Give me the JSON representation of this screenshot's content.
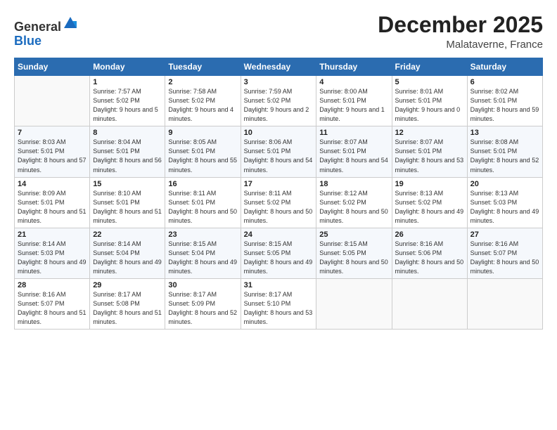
{
  "header": {
    "logo_line1": "General",
    "logo_line2": "Blue",
    "month": "December 2025",
    "location": "Malataverne, France"
  },
  "weekdays": [
    "Sunday",
    "Monday",
    "Tuesday",
    "Wednesday",
    "Thursday",
    "Friday",
    "Saturday"
  ],
  "weeks": [
    [
      {
        "day": "",
        "sunrise": "",
        "sunset": "",
        "daylight": ""
      },
      {
        "day": "1",
        "sunrise": "Sunrise: 7:57 AM",
        "sunset": "Sunset: 5:02 PM",
        "daylight": "Daylight: 9 hours and 5 minutes."
      },
      {
        "day": "2",
        "sunrise": "Sunrise: 7:58 AM",
        "sunset": "Sunset: 5:02 PM",
        "daylight": "Daylight: 9 hours and 4 minutes."
      },
      {
        "day": "3",
        "sunrise": "Sunrise: 7:59 AM",
        "sunset": "Sunset: 5:02 PM",
        "daylight": "Daylight: 9 hours and 2 minutes."
      },
      {
        "day": "4",
        "sunrise": "Sunrise: 8:00 AM",
        "sunset": "Sunset: 5:01 PM",
        "daylight": "Daylight: 9 hours and 1 minute."
      },
      {
        "day": "5",
        "sunrise": "Sunrise: 8:01 AM",
        "sunset": "Sunset: 5:01 PM",
        "daylight": "Daylight: 9 hours and 0 minutes."
      },
      {
        "day": "6",
        "sunrise": "Sunrise: 8:02 AM",
        "sunset": "Sunset: 5:01 PM",
        "daylight": "Daylight: 8 hours and 59 minutes."
      }
    ],
    [
      {
        "day": "7",
        "sunrise": "Sunrise: 8:03 AM",
        "sunset": "Sunset: 5:01 PM",
        "daylight": "Daylight: 8 hours and 57 minutes."
      },
      {
        "day": "8",
        "sunrise": "Sunrise: 8:04 AM",
        "sunset": "Sunset: 5:01 PM",
        "daylight": "Daylight: 8 hours and 56 minutes."
      },
      {
        "day": "9",
        "sunrise": "Sunrise: 8:05 AM",
        "sunset": "Sunset: 5:01 PM",
        "daylight": "Daylight: 8 hours and 55 minutes."
      },
      {
        "day": "10",
        "sunrise": "Sunrise: 8:06 AM",
        "sunset": "Sunset: 5:01 PM",
        "daylight": "Daylight: 8 hours and 54 minutes."
      },
      {
        "day": "11",
        "sunrise": "Sunrise: 8:07 AM",
        "sunset": "Sunset: 5:01 PM",
        "daylight": "Daylight: 8 hours and 54 minutes."
      },
      {
        "day": "12",
        "sunrise": "Sunrise: 8:07 AM",
        "sunset": "Sunset: 5:01 PM",
        "daylight": "Daylight: 8 hours and 53 minutes."
      },
      {
        "day": "13",
        "sunrise": "Sunrise: 8:08 AM",
        "sunset": "Sunset: 5:01 PM",
        "daylight": "Daylight: 8 hours and 52 minutes."
      }
    ],
    [
      {
        "day": "14",
        "sunrise": "Sunrise: 8:09 AM",
        "sunset": "Sunset: 5:01 PM",
        "daylight": "Daylight: 8 hours and 51 minutes."
      },
      {
        "day": "15",
        "sunrise": "Sunrise: 8:10 AM",
        "sunset": "Sunset: 5:01 PM",
        "daylight": "Daylight: 8 hours and 51 minutes."
      },
      {
        "day": "16",
        "sunrise": "Sunrise: 8:11 AM",
        "sunset": "Sunset: 5:01 PM",
        "daylight": "Daylight: 8 hours and 50 minutes."
      },
      {
        "day": "17",
        "sunrise": "Sunrise: 8:11 AM",
        "sunset": "Sunset: 5:02 PM",
        "daylight": "Daylight: 8 hours and 50 minutes."
      },
      {
        "day": "18",
        "sunrise": "Sunrise: 8:12 AM",
        "sunset": "Sunset: 5:02 PM",
        "daylight": "Daylight: 8 hours and 50 minutes."
      },
      {
        "day": "19",
        "sunrise": "Sunrise: 8:13 AM",
        "sunset": "Sunset: 5:02 PM",
        "daylight": "Daylight: 8 hours and 49 minutes."
      },
      {
        "day": "20",
        "sunrise": "Sunrise: 8:13 AM",
        "sunset": "Sunset: 5:03 PM",
        "daylight": "Daylight: 8 hours and 49 minutes."
      }
    ],
    [
      {
        "day": "21",
        "sunrise": "Sunrise: 8:14 AM",
        "sunset": "Sunset: 5:03 PM",
        "daylight": "Daylight: 8 hours and 49 minutes."
      },
      {
        "day": "22",
        "sunrise": "Sunrise: 8:14 AM",
        "sunset": "Sunset: 5:04 PM",
        "daylight": "Daylight: 8 hours and 49 minutes."
      },
      {
        "day": "23",
        "sunrise": "Sunrise: 8:15 AM",
        "sunset": "Sunset: 5:04 PM",
        "daylight": "Daylight: 8 hours and 49 minutes."
      },
      {
        "day": "24",
        "sunrise": "Sunrise: 8:15 AM",
        "sunset": "Sunset: 5:05 PM",
        "daylight": "Daylight: 8 hours and 49 minutes."
      },
      {
        "day": "25",
        "sunrise": "Sunrise: 8:15 AM",
        "sunset": "Sunset: 5:05 PM",
        "daylight": "Daylight: 8 hours and 50 minutes."
      },
      {
        "day": "26",
        "sunrise": "Sunrise: 8:16 AM",
        "sunset": "Sunset: 5:06 PM",
        "daylight": "Daylight: 8 hours and 50 minutes."
      },
      {
        "day": "27",
        "sunrise": "Sunrise: 8:16 AM",
        "sunset": "Sunset: 5:07 PM",
        "daylight": "Daylight: 8 hours and 50 minutes."
      }
    ],
    [
      {
        "day": "28",
        "sunrise": "Sunrise: 8:16 AM",
        "sunset": "Sunset: 5:07 PM",
        "daylight": "Daylight: 8 hours and 51 minutes."
      },
      {
        "day": "29",
        "sunrise": "Sunrise: 8:17 AM",
        "sunset": "Sunset: 5:08 PM",
        "daylight": "Daylight: 8 hours and 51 minutes."
      },
      {
        "day": "30",
        "sunrise": "Sunrise: 8:17 AM",
        "sunset": "Sunset: 5:09 PM",
        "daylight": "Daylight: 8 hours and 52 minutes."
      },
      {
        "day": "31",
        "sunrise": "Sunrise: 8:17 AM",
        "sunset": "Sunset: 5:10 PM",
        "daylight": "Daylight: 8 hours and 53 minutes."
      },
      {
        "day": "",
        "sunrise": "",
        "sunset": "",
        "daylight": ""
      },
      {
        "day": "",
        "sunrise": "",
        "sunset": "",
        "daylight": ""
      },
      {
        "day": "",
        "sunrise": "",
        "sunset": "",
        "daylight": ""
      }
    ]
  ]
}
